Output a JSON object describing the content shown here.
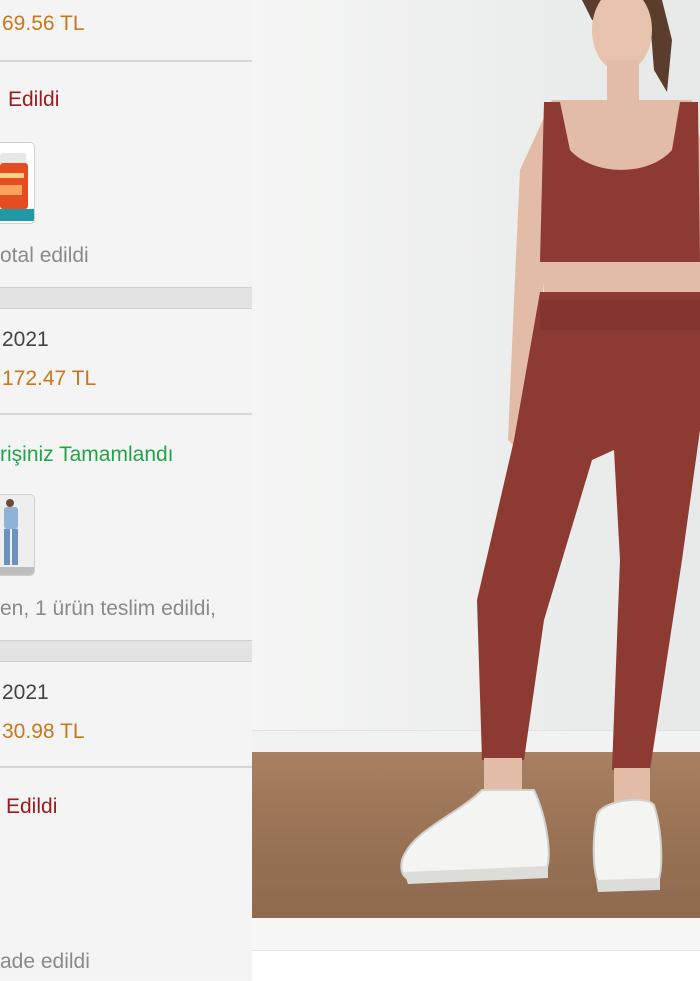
{
  "orders": [
    {
      "price": "69.56 TL",
      "status": "Edildi",
      "note": "otal edildi"
    },
    {
      "date": "2021",
      "price": "172.47 TL",
      "status": "rişiniz Tamamlandı",
      "note": "en, 1 ürün teslim edildi,"
    },
    {
      "date": "2021",
      "price": "30.98 TL",
      "status": "Edildi",
      "note": "ade edildi"
    }
  ],
  "colors": {
    "price": "#c8781a",
    "cancelled": "#9a1b1b",
    "completed": "#22a34a",
    "outfit": "#8d3a32"
  },
  "icons": [
    "product-thumbnail-supplement",
    "product-thumbnail-denim-outfit"
  ]
}
